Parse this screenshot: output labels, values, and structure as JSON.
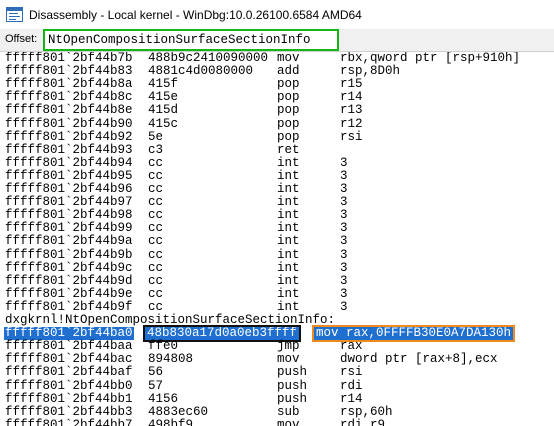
{
  "window": {
    "title": "Disassembly - Local kernel - WinDbg:10.0.26100.6584 AMD64"
  },
  "offset": {
    "label": "Offset:",
    "value": "NtOpenCompositionSurfaceSectionInfo"
  },
  "lines_before": [
    {
      "addr": "fffff801`2bf44b7b",
      "bytes": "488b9c2410090000",
      "mnemonic": "mov",
      "operands": "rbx,qword ptr [rsp+910h]"
    },
    {
      "addr": "fffff801`2bf44b83",
      "bytes": "4881c4d0080000",
      "mnemonic": "add",
      "operands": "rsp,8D0h"
    },
    {
      "addr": "fffff801`2bf44b8a",
      "bytes": "415f",
      "mnemonic": "pop",
      "operands": "r15"
    },
    {
      "addr": "fffff801`2bf44b8c",
      "bytes": "415e",
      "mnemonic": "pop",
      "operands": "r14"
    },
    {
      "addr": "fffff801`2bf44b8e",
      "bytes": "415d",
      "mnemonic": "pop",
      "operands": "r13"
    },
    {
      "addr": "fffff801`2bf44b90",
      "bytes": "415c",
      "mnemonic": "pop",
      "operands": "r12"
    },
    {
      "addr": "fffff801`2bf44b92",
      "bytes": "5e",
      "mnemonic": "pop",
      "operands": "rsi"
    },
    {
      "addr": "fffff801`2bf44b93",
      "bytes": "c3",
      "mnemonic": "ret",
      "operands": ""
    },
    {
      "addr": "fffff801`2bf44b94",
      "bytes": "cc",
      "mnemonic": "int",
      "operands": "3"
    },
    {
      "addr": "fffff801`2bf44b95",
      "bytes": "cc",
      "mnemonic": "int",
      "operands": "3"
    },
    {
      "addr": "fffff801`2bf44b96",
      "bytes": "cc",
      "mnemonic": "int",
      "operands": "3"
    },
    {
      "addr": "fffff801`2bf44b97",
      "bytes": "cc",
      "mnemonic": "int",
      "operands": "3"
    },
    {
      "addr": "fffff801`2bf44b98",
      "bytes": "cc",
      "mnemonic": "int",
      "operands": "3"
    },
    {
      "addr": "fffff801`2bf44b99",
      "bytes": "cc",
      "mnemonic": "int",
      "operands": "3"
    },
    {
      "addr": "fffff801`2bf44b9a",
      "bytes": "cc",
      "mnemonic": "int",
      "operands": "3"
    },
    {
      "addr": "fffff801`2bf44b9b",
      "bytes": "cc",
      "mnemonic": "int",
      "operands": "3"
    },
    {
      "addr": "fffff801`2bf44b9c",
      "bytes": "cc",
      "mnemonic": "int",
      "operands": "3"
    },
    {
      "addr": "fffff801`2bf44b9d",
      "bytes": "cc",
      "mnemonic": "int",
      "operands": "3"
    },
    {
      "addr": "fffff801`2bf44b9e",
      "bytes": "cc",
      "mnemonic": "int",
      "operands": "3"
    },
    {
      "addr": "fffff801`2bf44b9f",
      "bytes": "cc",
      "mnemonic": "int",
      "operands": "3"
    }
  ],
  "symbol_label": "dxgkrnl!NtOpenCompositionSurfaceSectionInfo:",
  "current_line": {
    "addr": "fffff801`2bf44ba0",
    "bytes": "48b830a17d0a0eb3ffff",
    "instruction": "mov rax,0FFFFB30E0A7DA130h"
  },
  "lines_after": [
    {
      "addr": "fffff801`2bf44baa",
      "bytes": "ffe0",
      "mnemonic": "jmp",
      "operands": "rax"
    },
    {
      "addr": "fffff801`2bf44bac",
      "bytes": "894808",
      "mnemonic": "mov",
      "operands": "dword ptr [rax+8],ecx"
    },
    {
      "addr": "fffff801`2bf44baf",
      "bytes": "56",
      "mnemonic": "push",
      "operands": "rsi"
    },
    {
      "addr": "fffff801`2bf44bb0",
      "bytes": "57",
      "mnemonic": "push",
      "operands": "rdi"
    },
    {
      "addr": "fffff801`2bf44bb1",
      "bytes": "4156",
      "mnemonic": "push",
      "operands": "r14"
    },
    {
      "addr": "fffff801`2bf44bb3",
      "bytes": "4883ec60",
      "mnemonic": "sub",
      "operands": "rsp,60h"
    },
    {
      "addr": "fffff801`2bf44bb7",
      "bytes": "498bf9",
      "mnemonic": "mov",
      "operands": "rdi,r9"
    }
  ]
}
